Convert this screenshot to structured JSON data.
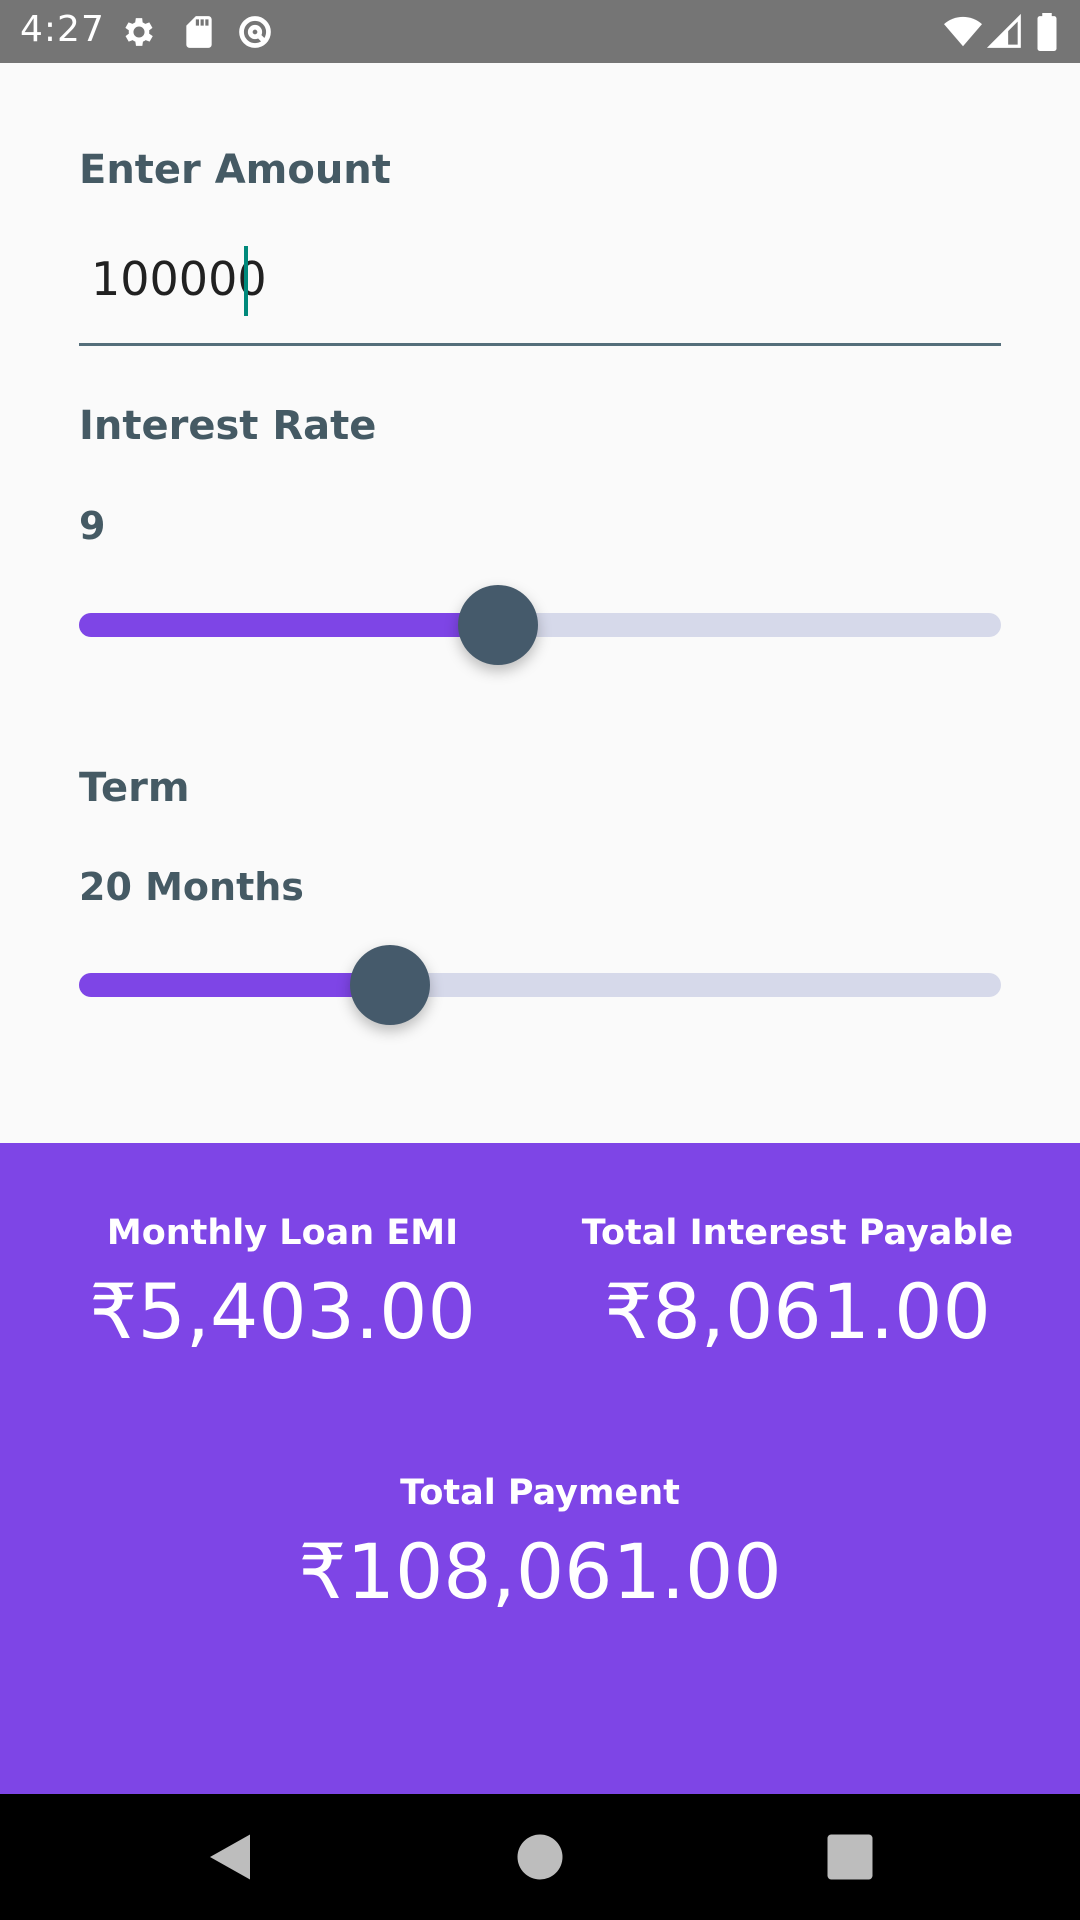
{
  "status_bar": {
    "time": "4:27",
    "icons": [
      "settings-icon",
      "sd-card-icon",
      "data-saver-icon",
      "wifi-icon",
      "cell-signal-icon",
      "battery-icon"
    ]
  },
  "form": {
    "amount_label": "Enter Amount",
    "amount_value": "100000",
    "interest_label": "Interest Rate",
    "interest_value": "9",
    "interest_slider_fraction": 0.454,
    "term_label": "Term",
    "term_value": "20 Months",
    "term_slider_fraction": 0.337
  },
  "results": {
    "emi_title": "Monthly Loan EMI",
    "emi_value": "₹5,403.00",
    "interest_title": "Total Interest Payable",
    "interest_value": "₹8,061.00",
    "total_title": "Total Payment",
    "total_value": "₹108,061.00"
  },
  "nav_bar": {
    "buttons": [
      "back-icon",
      "home-icon",
      "recents-icon"
    ]
  },
  "colors": {
    "accent": "#7e45e6",
    "text_primary": "#455a64",
    "thumb": "#455a6b",
    "track": "#d6d9ea",
    "status_bar": "#757575",
    "cursor": "#00897b"
  }
}
